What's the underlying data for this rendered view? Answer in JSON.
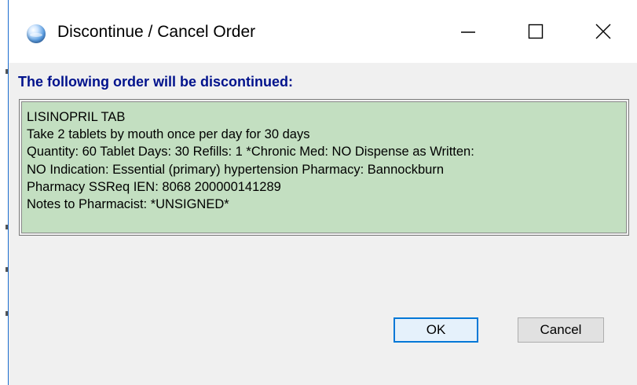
{
  "window": {
    "title": "Discontinue / Cancel Order",
    "icon": "app-globe-icon",
    "controls": [
      "minimize-icon",
      "maximize-icon",
      "close-icon"
    ]
  },
  "heading": "The following order will be discontinued:",
  "order": {
    "lines": [
      "LISINOPRIL TAB",
      "Take 2 tablets by mouth once per day for 30 days",
      "Quantity: 60 Tablet Days: 30 Refills: 1 *Chronic Med: NO Dispense as Written:",
      "NO Indication: Essential (primary) hypertension Pharmacy: Bannockburn",
      "Pharmacy SSReq IEN: 8068 200000141289",
      "Notes to Pharmacist:  *UNSIGNED*"
    ]
  },
  "buttons": {
    "ok": "OK",
    "cancel": "Cancel"
  },
  "colors": {
    "heading": "#00128c",
    "panel_background": "#c3dfc1",
    "window_border": "#1c6dcf",
    "default_button_border": "#0078d7"
  }
}
